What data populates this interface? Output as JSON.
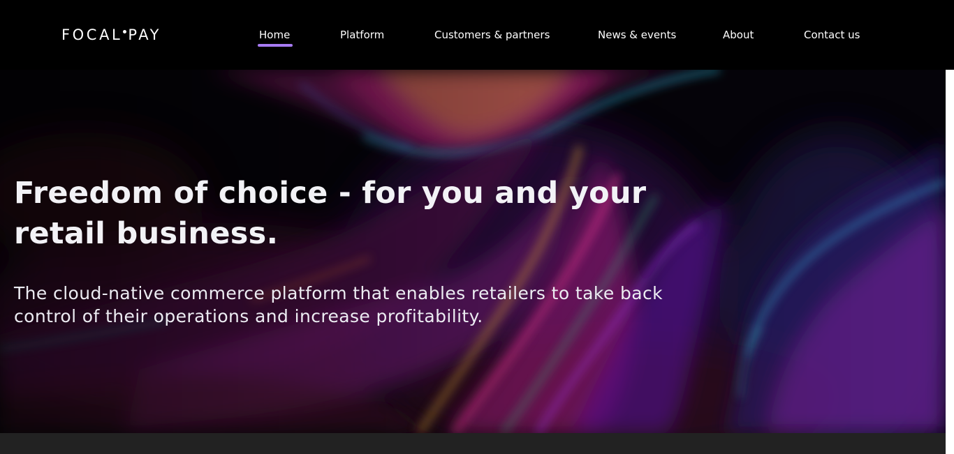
{
  "header": {
    "logo": {
      "text_left": "FOCAL",
      "text_right": "PAY"
    },
    "nav": {
      "items": [
        {
          "label": "Home",
          "active": true
        },
        {
          "label": "Platform",
          "active": false
        },
        {
          "label": "Customers & partners",
          "active": false
        },
        {
          "label": "News & events",
          "active": false
        },
        {
          "label": "About",
          "active": false
        },
        {
          "label": "Contact us",
          "active": false
        }
      ]
    }
  },
  "hero": {
    "title": "Freedom of choice - for you and your retail business.",
    "subtitle": "The cloud-native commerce platform that enables retailers to take back control of their operations and increase profitability."
  },
  "colors": {
    "header_bg": "#000000",
    "active_underline": "#a77bf3",
    "hero_text": "#f2f2f6",
    "bottom_band": "#222222"
  }
}
